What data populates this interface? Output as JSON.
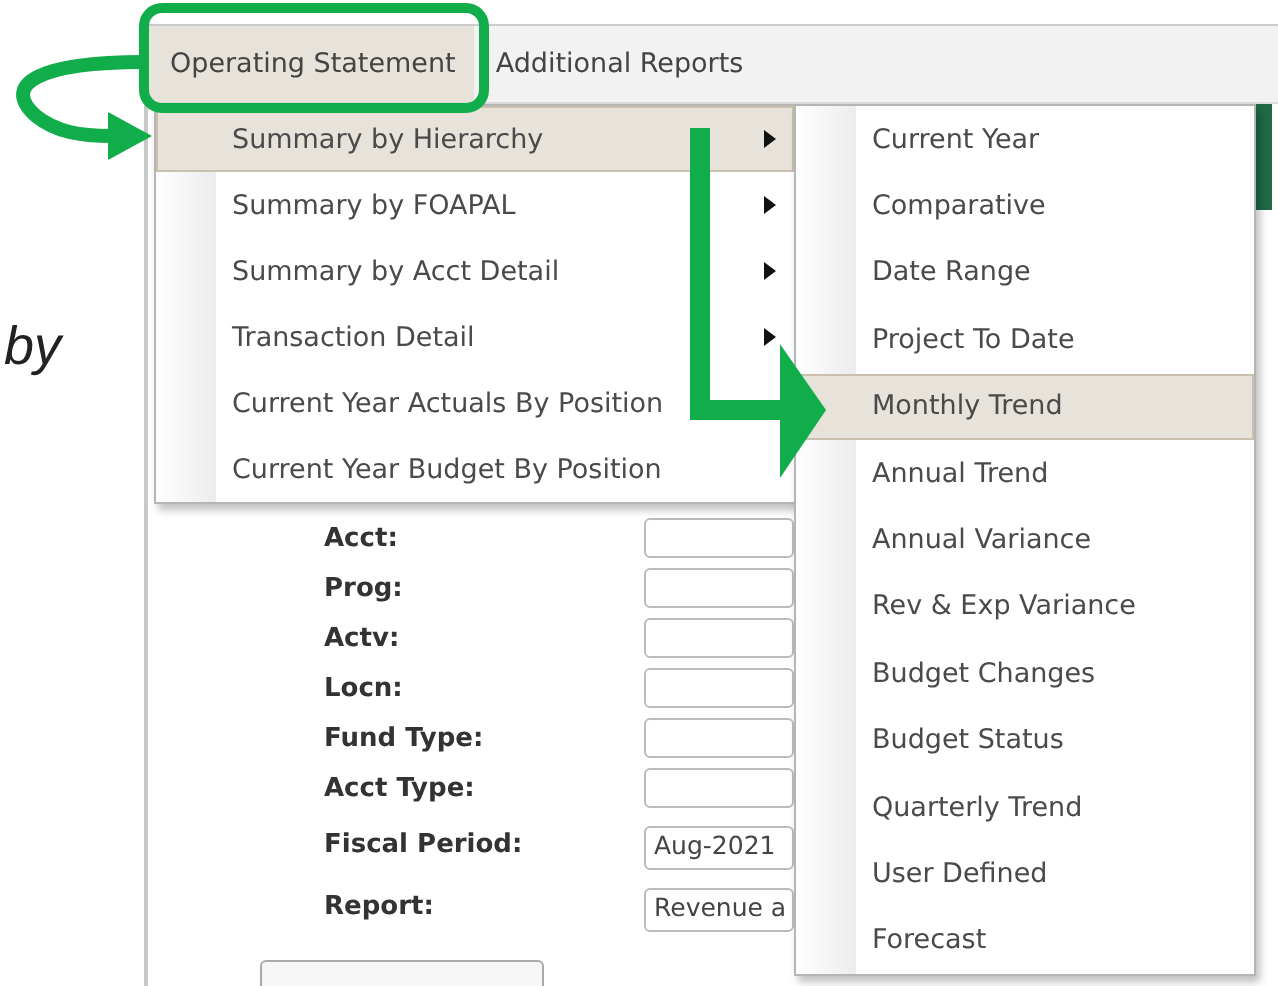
{
  "annotation_text": "by",
  "menubar": [
    {
      "label": "Operating Statement",
      "selected": true
    },
    {
      "label": "Additional Reports",
      "selected": false
    }
  ],
  "menu": [
    {
      "label": "Summary by Hierarchy",
      "selected": true,
      "has_submenu": true
    },
    {
      "label": "Summary by FOAPAL",
      "selected": false,
      "has_submenu": true
    },
    {
      "label": "Summary by Acct Detail",
      "selected": false,
      "has_submenu": true
    },
    {
      "label": "Transaction Detail",
      "selected": false,
      "has_submenu": true
    },
    {
      "label": "Current Year Actuals By Position",
      "selected": false,
      "has_submenu": false
    },
    {
      "label": "Current Year Budget By Position",
      "selected": false,
      "has_submenu": false
    }
  ],
  "submenu": [
    {
      "label": "Current Year",
      "selected": false
    },
    {
      "label": "Comparative",
      "selected": false
    },
    {
      "label": "Date Range",
      "selected": false
    },
    {
      "label": "Project To Date",
      "selected": false
    },
    {
      "label": "Monthly Trend",
      "selected": true
    },
    {
      "label": "Annual Trend",
      "selected": false
    },
    {
      "label": "Annual Variance",
      "selected": false
    },
    {
      "label": "Rev & Exp Variance",
      "selected": false
    },
    {
      "label": "Budget Changes",
      "selected": false
    },
    {
      "label": "Budget Status",
      "selected": false
    },
    {
      "label": "Quarterly Trend",
      "selected": false
    },
    {
      "label": "User Defined",
      "selected": false
    },
    {
      "label": "Forecast",
      "selected": false
    }
  ],
  "form": [
    {
      "label": "Acct:"
    },
    {
      "label": "Prog:"
    },
    {
      "label": "Actv:"
    },
    {
      "label": "Locn:"
    },
    {
      "label": "Fund Type:"
    },
    {
      "label": "Acct Type:"
    },
    {
      "label": "Fiscal Period:",
      "value": "Aug-2021"
    },
    {
      "label": "Report:",
      "value": "Revenue a"
    }
  ]
}
